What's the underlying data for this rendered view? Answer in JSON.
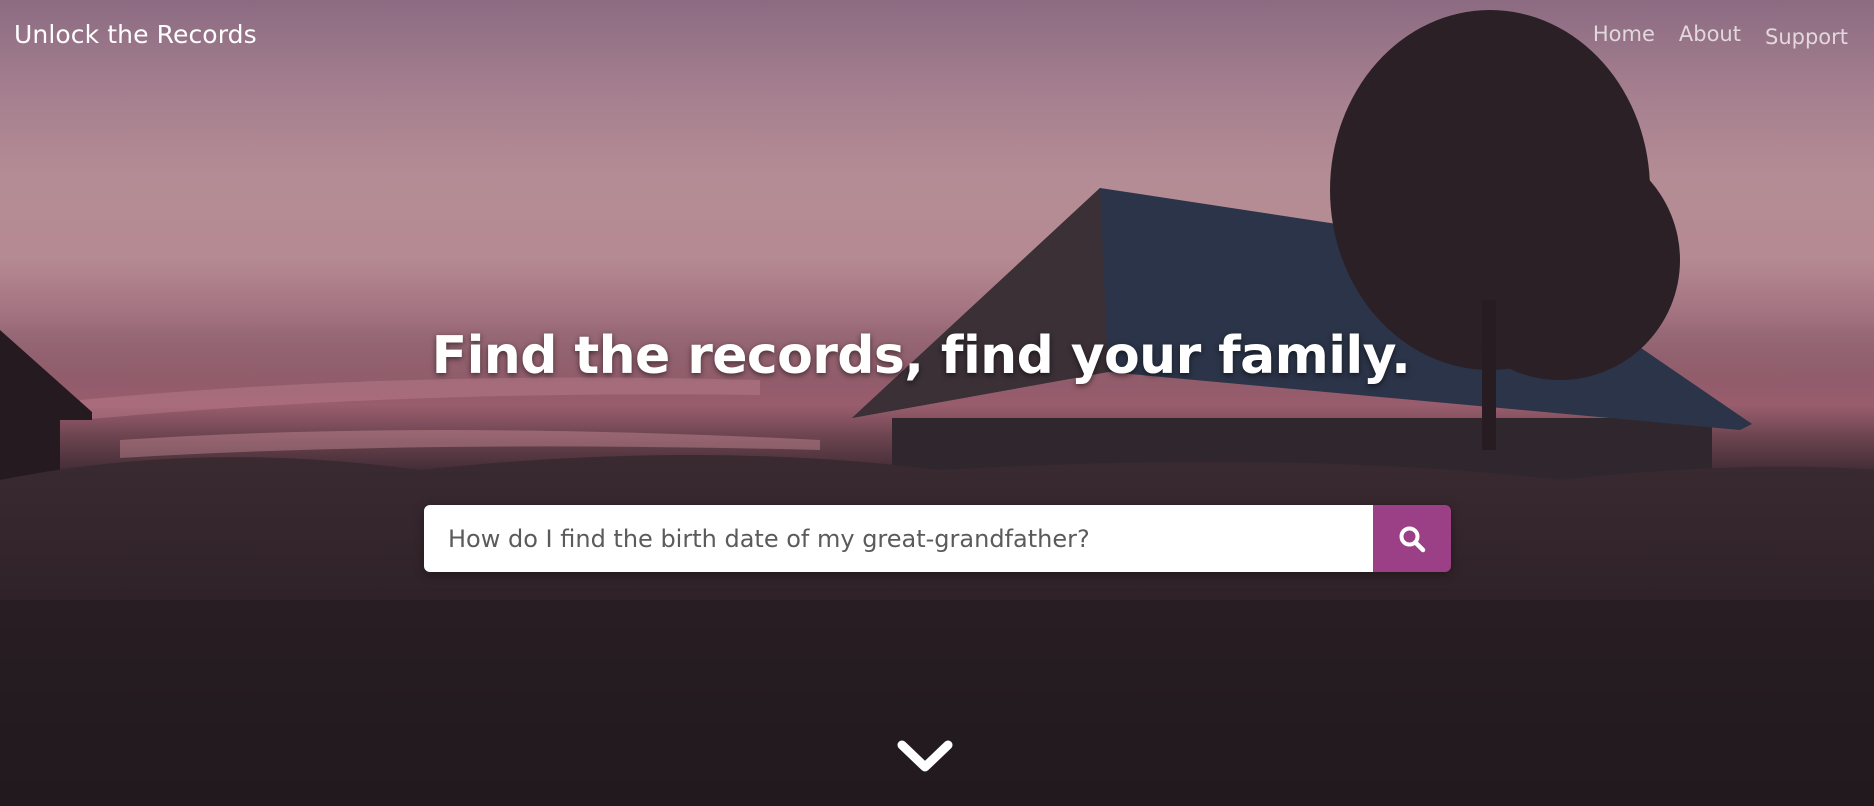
{
  "navbar": {
    "brand": "Unlock the Records",
    "links": [
      {
        "label": "Home"
      },
      {
        "label": "About"
      },
      {
        "label": "Support"
      }
    ]
  },
  "hero": {
    "headline": "Find the records, find your family.",
    "search": {
      "placeholder": "How do I find the birth date of my great-grandfather?",
      "value": "",
      "button_icon": "search-icon"
    },
    "scroll_icon": "chevron-down-icon"
  },
  "colors": {
    "accent": "#9b3f86",
    "text_light": "#ffffff"
  }
}
